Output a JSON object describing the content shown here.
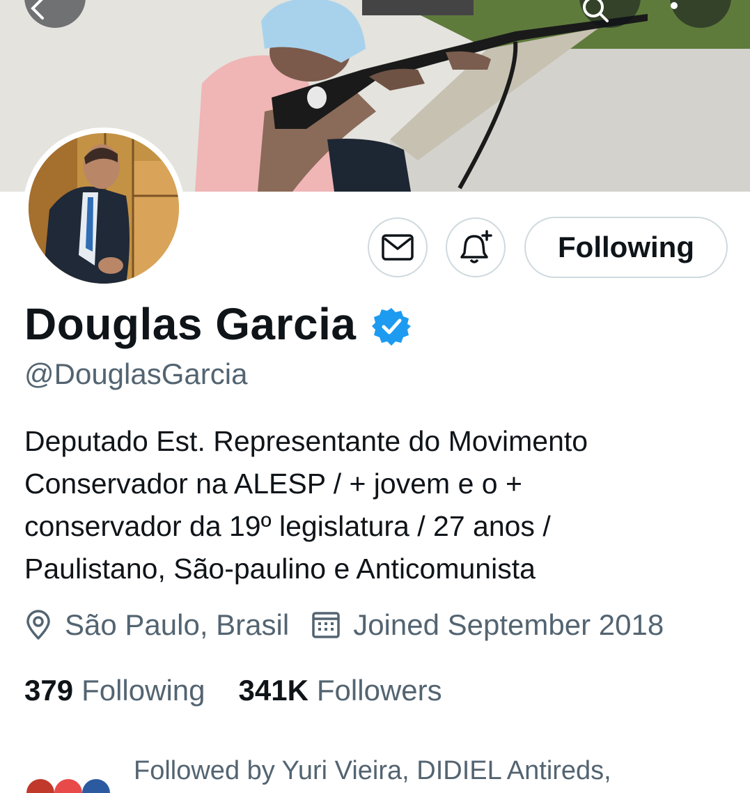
{
  "profile": {
    "display_name": "Douglas Garcia",
    "handle": "@DouglasGarcia",
    "bio": "Deputado Est. Representante do Movimento\nConservador na ALESP / + jovem e o +\nconservador da 19º legislatura / 27 anos /\nPaulistano, São-paulino e Anticomunista",
    "location": "São Paulo, Brasil",
    "joined": "Joined September 2018",
    "verified": true
  },
  "actions": {
    "follow_label": "Following"
  },
  "stats": {
    "following_count": "379",
    "following_label": "Following",
    "followers_count": "341K",
    "followers_label": "Followers"
  },
  "followed_by": "Followed by Yuri Vieira, DIDIEL Antireds,",
  "icons": {
    "back": "back-arrow-icon",
    "search": "search-icon",
    "more": "more-vertical-icon",
    "message": "envelope-icon",
    "notify": "bell-plus-icon",
    "location": "location-pin-icon",
    "calendar": "calendar-icon",
    "verified": "verified-badge-icon"
  },
  "colors": {
    "accent": "#1d9bf0",
    "secondary_text": "#536471",
    "border": "#cfd9de"
  }
}
